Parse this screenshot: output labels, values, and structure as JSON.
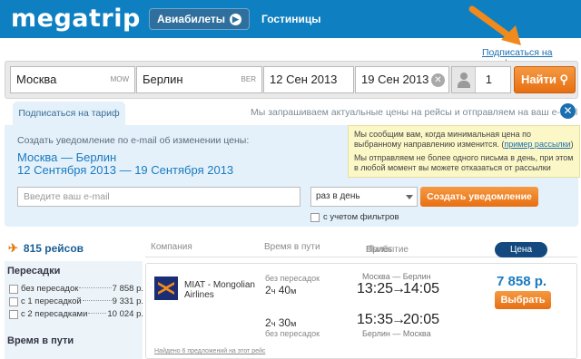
{
  "header": {
    "logo": "megatrip",
    "nav_flights": "Авиабилеты",
    "nav_hotels": "Гостиницы"
  },
  "subscribe_link": "Подписаться на тариф",
  "search": {
    "from": "Москва",
    "from_code": "MOW",
    "to": "Берлин",
    "to_code": "BER",
    "date_out": "12 Сен 2013",
    "date_back": "19 Сен 2013",
    "passengers": "1",
    "search_button": "Найти"
  },
  "subscription": {
    "tab_label": "Подписаться на тариф",
    "note": "Мы запрашиваем актуальные цены на рейсы и отправляем на ваш e-mail",
    "description": "Создать уведомление по e-mail об изменении цены:",
    "route": "Москва — Берлин",
    "dates": "12 Сентября 2013 — 19 Сентября 2013",
    "info_1": "Мы сообщим вам, когда минимальная цена по выбранному направлению изменится. (",
    "info_link": "пример рассылки",
    "info_1_end": ")",
    "info_2": "Мы отправляем не более одного письма в день, при этом в любой момент вы можете отказаться от рассылки",
    "email_placeholder": "Введите ваш e-mail",
    "frequency": "раз в день",
    "create_button": "Создать уведомление",
    "filters_label": "с учетом фильтров"
  },
  "results": {
    "count": "815 рейсов",
    "col_company": "Компания",
    "col_duration": "Время в пути",
    "col_departure": "Вылет",
    "col_arrival": "Прибытие",
    "col_price": "Цена"
  },
  "sidebar": {
    "stops_title": "Пересадки",
    "stops": [
      {
        "label": "без пересадок",
        "price": "7 858 р."
      },
      {
        "label": "с 1 пересадкой",
        "price": "9 331 р."
      },
      {
        "label": "с 2 пересадками",
        "price": "10 024 р."
      }
    ],
    "duration_title": "Время в пути"
  },
  "offer": {
    "airline": "MIAT - Mongolian Airlines",
    "seg1": {
      "stops": "без пересадок",
      "dur_h": "2",
      "dur_h_unit": "ч",
      "dur_m": "40",
      "dur_m_unit": "м",
      "route": "Москва — Берлин",
      "dep": "13:25",
      "arr": "14:05"
    },
    "seg2": {
      "stops": "без пересадок",
      "dur_h": "2",
      "dur_h_unit": "ч",
      "dur_m": "30",
      "dur_m_unit": "м",
      "route": "Берлин — Москва",
      "dep": "15:35",
      "arr": "20:05"
    },
    "price": "7 858 р.",
    "choose_button": "Выбрать",
    "found_note": "Найдено 6 предложений на этот рейс"
  },
  "colors": {
    "brand_blue": "#0e7fc0",
    "accent_orange": "#e86f12"
  }
}
